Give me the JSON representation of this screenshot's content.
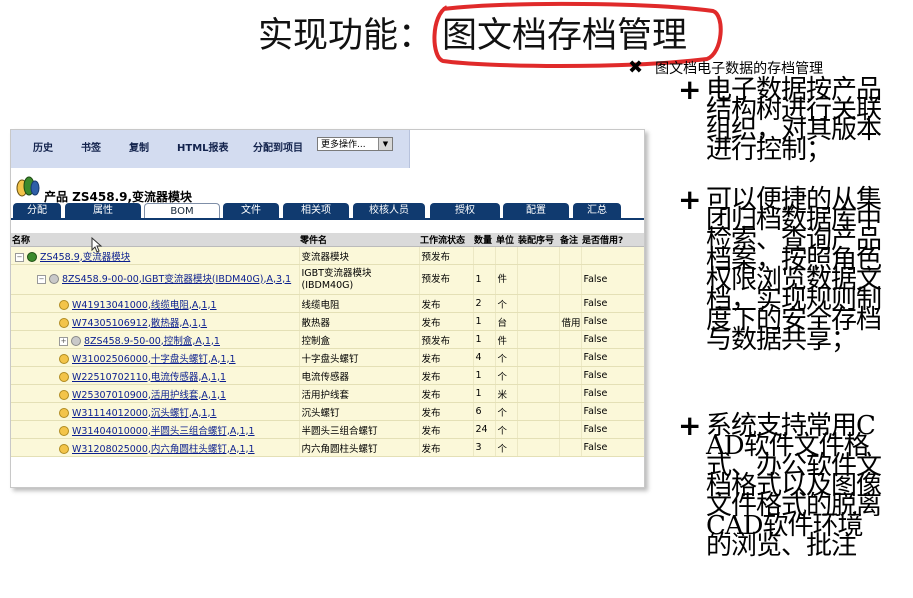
{
  "slide": {
    "title_prefix": "实现功能：",
    "title_highlight": "图文档存档管理",
    "small_bullet": "图文档电子数据的存档管理",
    "bullets": [
      "电子数据按产品结构树进行关联组织，对其版本进行控制；",
      "可以便捷的从集团归档数据库中检索、查询产品档案，按照角色权限浏览数据文档，实现规则制度下的安全存档与数据共享；",
      "系统支持常用CAD软件文件格式、办公软件文档格式以及图像文件格式的脱离CAD软件环境的浏览、批注"
    ],
    "colors": {
      "circle": "#e02a2a"
    }
  },
  "app": {
    "toolbar": {
      "items": [
        "历史",
        "书签",
        "复制",
        "HTML报表",
        "分配到项目"
      ],
      "more_select": "更多操作..."
    },
    "product_title": "产品 ZS458.9,变流器模块",
    "tabs": [
      "分配",
      "属性",
      "BOM",
      "文件",
      "相关项",
      "校核人员",
      "授权",
      "配置",
      "汇总"
    ],
    "active_tab": "BOM",
    "columns": [
      "名称",
      "零件名",
      "工作流状态",
      "数量",
      "单位",
      "装配序号",
      "备注",
      "是否借用?"
    ],
    "rows": [
      {
        "name": "ZS458.9,变流器模块",
        "part": "变流器模块",
        "status": "预发布",
        "qty": "",
        "unit": "",
        "seq": "",
        "note": "",
        "borrow": "",
        "level": 0,
        "icon": "multi",
        "toggle": "-"
      },
      {
        "name": "8ZS458.9-00-00,IGBT变流器模块(IBDM40G),A,3,1",
        "part": "IGBT变流器模块(IBDM40G)",
        "status": "预发布",
        "qty": "1",
        "unit": "件",
        "seq": "",
        "note": "",
        "borrow": "False",
        "level": 1,
        "icon": "grey",
        "toggle": "-",
        "tall": true
      },
      {
        "name": "W41913041000,线缆电阻,A,1,1",
        "part": "线缆电阻",
        "status": "发布",
        "qty": "2",
        "unit": "个",
        "seq": "",
        "note": "",
        "borrow": "False",
        "level": 2,
        "icon": "part",
        "toggle": ""
      },
      {
        "name": "W74305106912,散热器,A,1,1",
        "part": "散热器",
        "status": "发布",
        "qty": "1",
        "unit": "台",
        "seq": "",
        "note": "借用",
        "borrow": "False",
        "level": 2,
        "icon": "part",
        "toggle": ""
      },
      {
        "name": "8ZS458.9-50-00,控制盒,A,1,1",
        "part": "控制盒",
        "status": "预发布",
        "qty": "1",
        "unit": "件",
        "seq": "",
        "note": "",
        "borrow": "False",
        "level": 2,
        "icon": "grey",
        "toggle": "+"
      },
      {
        "name": "W31002506000,十字盘头螺钉,A,1,1",
        "part": "十字盘头螺钉",
        "status": "发布",
        "qty": "4",
        "unit": "个",
        "seq": "",
        "note": "",
        "borrow": "False",
        "level": 2,
        "icon": "part",
        "toggle": ""
      },
      {
        "name": "W22510702110,电流传感器,A,1,1",
        "part": "电流传感器",
        "status": "发布",
        "qty": "1",
        "unit": "个",
        "seq": "",
        "note": "",
        "borrow": "False",
        "level": 2,
        "icon": "part",
        "toggle": ""
      },
      {
        "name": "W25307010900,活用护线套,A,1,1",
        "part": "活用护线套",
        "status": "发布",
        "qty": "1",
        "unit": "米",
        "seq": "",
        "note": "",
        "borrow": "False",
        "level": 2,
        "icon": "part",
        "toggle": ""
      },
      {
        "name": "W31114012000,沉头螺钉,A,1,1",
        "part": "沉头螺钉",
        "status": "发布",
        "qty": "6",
        "unit": "个",
        "seq": "",
        "note": "",
        "borrow": "False",
        "level": 2,
        "icon": "part",
        "toggle": ""
      },
      {
        "name": "W31404010000,半圆头三组合螺钉,A,1,1",
        "part": "半圆头三组合螺钉",
        "status": "发布",
        "qty": "24",
        "unit": "个",
        "seq": "",
        "note": "",
        "borrow": "False",
        "level": 2,
        "icon": "part",
        "toggle": ""
      },
      {
        "name": "W31208025000,内六角圆柱头螺钉,A,1,1",
        "part": "内六角圆柱头螺钉",
        "status": "发布",
        "qty": "3",
        "unit": "个",
        "seq": "",
        "note": "",
        "borrow": "False",
        "level": 2,
        "icon": "part",
        "toggle": ""
      }
    ]
  }
}
